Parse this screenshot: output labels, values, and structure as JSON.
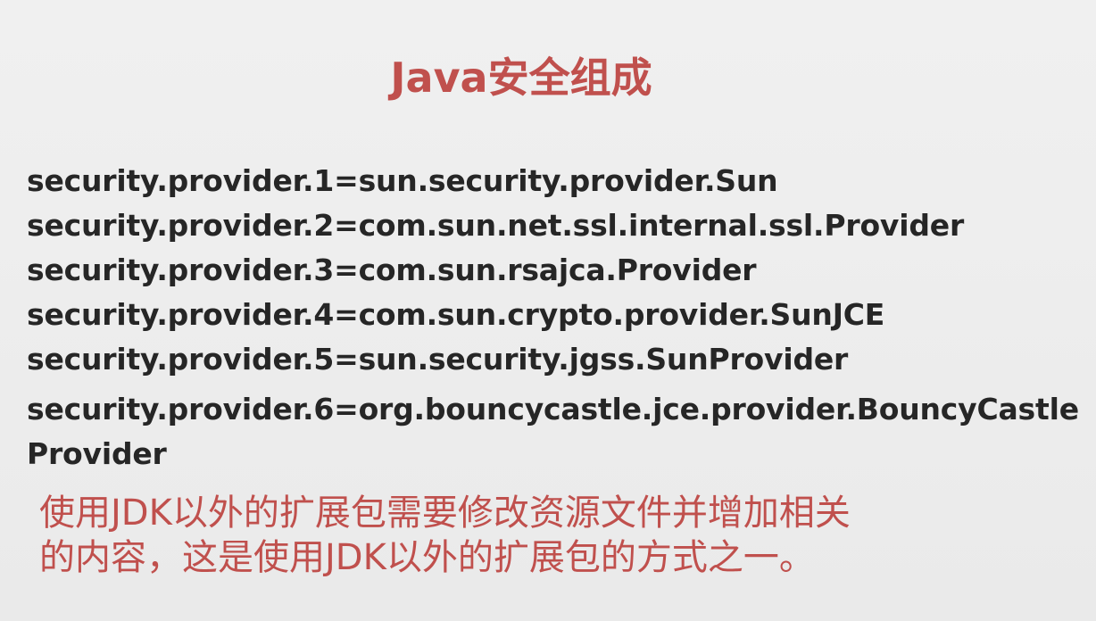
{
  "slide": {
    "title": "Java安全组成",
    "provider_lines": [
      "security.provider.1=sun.security.provider.Sun",
      "security.provider.2=com.sun.net.ssl.internal.ssl.Provider",
      "security.provider.3=com.sun.rsajca.Provider",
      "security.provider.4=com.sun.crypto.provider.SunJCE",
      "security.provider.5=sun.security.jgss.SunProvider",
      "security.provider.6=org.bouncycastle.jce.provider.BouncyCastleProvider"
    ],
    "note_lines": [
      "使用JDK以外的扩展包需要修改资源文件并增加相关",
      "的内容，这是使用JDK以外的扩展包的方式之一。"
    ]
  },
  "colors": {
    "accent": "#c0504d",
    "body_text": "#262626",
    "background": "#ececec"
  }
}
